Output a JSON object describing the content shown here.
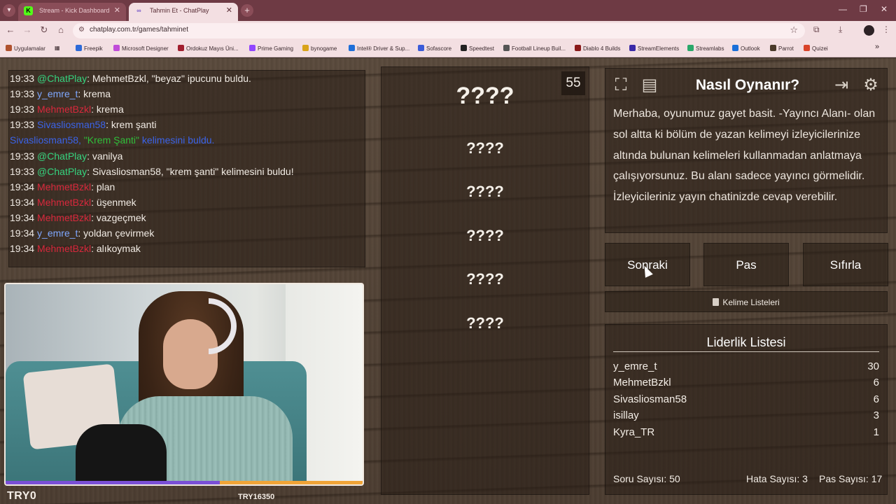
{
  "browser": {
    "tabs": [
      {
        "label": "Stream - Kick Dashboard",
        "favicon": "K"
      },
      {
        "label": "Tahmin Et - ChatPlay",
        "favicon": "∞"
      }
    ],
    "new_tab": "+",
    "url": "chatplay.com.tr/games/tahminet",
    "bookmarks": [
      {
        "label": "Uygulamalar",
        "color": "#b0522e"
      },
      {
        "label": "Freepik",
        "color": "#2d6ad8"
      },
      {
        "label": "Microsoft Designer",
        "color": "#c04bd8"
      },
      {
        "label": "Ordokuz Mayıs Üni...",
        "color": "#a11e2e"
      },
      {
        "label": "Prime Gaming",
        "color": "#9146ff"
      },
      {
        "label": "bynogame",
        "color": "#d9a31a"
      },
      {
        "label": "Intel® Driver & Sup...",
        "color": "#1e6fd9"
      },
      {
        "label": "Sofascore",
        "color": "#3b5cd9"
      },
      {
        "label": "Speedtest",
        "color": "#222222"
      },
      {
        "label": "Football Lineup Buil...",
        "color": "#555555"
      },
      {
        "label": "Diablo 4 Builds",
        "color": "#8a1a1a"
      },
      {
        "label": "StreamElements",
        "color": "#3a2aa8"
      },
      {
        "label": "Streamlabs",
        "color": "#2aa86a"
      },
      {
        "label": "Outlook",
        "color": "#1a6fd9"
      },
      {
        "label": "Parrot",
        "color": "#4a3a2a"
      },
      {
        "label": "Quizei",
        "color": "#d9442a"
      }
    ]
  },
  "chat": {
    "lines": [
      {
        "time": "19:33",
        "user": "@ChatPlay",
        "user_class": "u-green",
        "msg": "MehmetBzkl, \"beyaz\" ipucunu buldu."
      },
      {
        "time": "19:33",
        "user": "y_emre_t",
        "user_class": "u-blue",
        "msg": "krema"
      },
      {
        "time": "19:33",
        "user": "MehmetBzkl",
        "user_class": "u-red",
        "msg": "krema"
      },
      {
        "time": "19:33",
        "user": "Sivasliosman58",
        "user_class": "u-blue2",
        "msg": "krem şanti"
      },
      {
        "time": "19:33",
        "user": "@ChatPlay",
        "user_class": "u-green",
        "msg": "vanilya"
      },
      {
        "time": "19:33",
        "user": "@ChatPlay",
        "user_class": "u-green",
        "msg": "Sivasliosman58, \"krem şanti\" kelimesini buldu!"
      },
      {
        "time": "19:34",
        "user": "MehmetBzkl",
        "user_class": "u-red",
        "msg": "plan"
      },
      {
        "time": "19:34",
        "user": "MehmetBzkl",
        "user_class": "u-red",
        "msg": "üşenmek"
      },
      {
        "time": "19:34",
        "user": "MehmetBzkl",
        "user_class": "u-red",
        "msg": "vazgeçmek"
      },
      {
        "time": "19:34",
        "user": "y_emre_t",
        "user_class": "u-blue",
        "msg": "yoldan çevirmek"
      },
      {
        "time": "19:34",
        "user": "MehmetBzkl",
        "user_class": "u-red",
        "msg": "alıkoymak"
      }
    ],
    "system_notice": {
      "user": "Sivasliosman58",
      "found": "\"Krem Şanti\"",
      "text": "kelimesini buldu."
    }
  },
  "stream": {
    "name": "TRY0",
    "id": "TRY16350",
    "progress": 0.6
  },
  "game": {
    "timer": "55",
    "hidden_words": [
      "????",
      "????",
      "????",
      "????",
      "????",
      "????"
    ]
  },
  "howto": {
    "title": "Nasıl Oynanır?",
    "description": "Merhaba, oyunumuz gayet basit. -Yayıncı Alanı- olan sol altta ki bölüm de yazan kelimeyi izleyicilerinize altında bulunan kelimeleri kullanmadan anlatmaya çalışıyorsunuz. Bu alanı sadece yayıncı görmelidir. İzleyicileriniz yayın chatinizde cevap verebilir."
  },
  "controls": {
    "next": "Sonraki",
    "pass": "Pas",
    "reset": "Sıfırla",
    "word_lists": "Kelime Listeleri"
  },
  "leaderboard": {
    "title": "Liderlik Listesi",
    "rows": [
      {
        "name": "y_emre_t",
        "score": "30"
      },
      {
        "name": "MehmetBzkl",
        "score": "6"
      },
      {
        "name": "Sivasliosman58",
        "score": "6"
      },
      {
        "name": "isillay",
        "score": "3"
      },
      {
        "name": "Kyra_TR",
        "score": "1"
      }
    ]
  },
  "stats": {
    "questions": "Soru Sayısı: 50",
    "errors": "Hata Sayısı: 3",
    "passes": "Pas Sayısı: 17"
  }
}
